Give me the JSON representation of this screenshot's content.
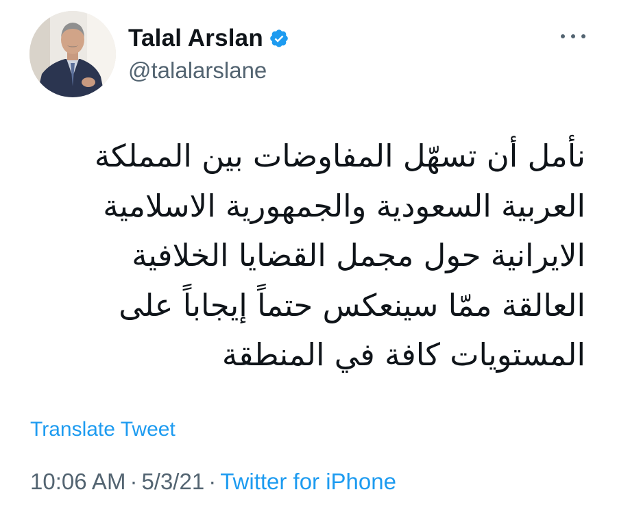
{
  "author": {
    "display_name": "Talal Arslan",
    "handle": "@talalarslane",
    "verified": true
  },
  "tweet": {
    "text_lines": [
      "نأمل أن تسهّل المفاوضات بين المملكة",
      "العربية السعودية والجمهورية الاسلامية",
      "الايرانية حول مجمل القضايا الخلافية",
      "العالقة ممّا سينعكس حتماً إيجاباً على",
      "المستويات كافة في المنطقة"
    ],
    "translate_label": "Translate Tweet",
    "time": "10:06 AM",
    "separator": "·",
    "date": "5/3/21",
    "source": "Twitter for iPhone"
  },
  "colors": {
    "accent": "#1d9bf0",
    "secondary_text": "#536471",
    "primary_text": "#0f1419"
  },
  "icons": {
    "verified": "verified-badge-icon",
    "more": "more-options-icon"
  }
}
